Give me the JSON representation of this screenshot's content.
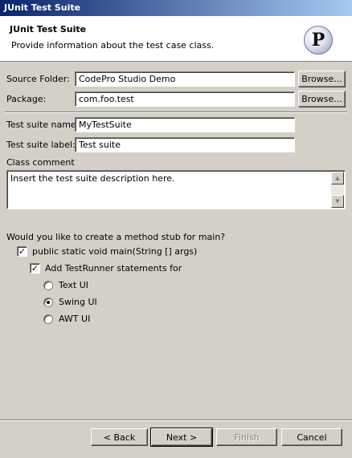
{
  "window": {
    "title": "JUnit Test Suite"
  },
  "header": {
    "title": "JUnit Test Suite",
    "description": "Provide information about the test case class.",
    "logo_letter": "P"
  },
  "form": {
    "source_folder": {
      "label": "Source Folder:",
      "value": "CodePro Studio Demo",
      "button": "Browse..."
    },
    "package": {
      "label": "Package:",
      "value": "com.foo.test",
      "button": "Browse..."
    },
    "suite_name": {
      "label": "Test suite name:",
      "value": "MyTestSuite"
    },
    "suite_label": {
      "label": "Test suite label:",
      "value": "Test suite"
    },
    "class_comment": {
      "label": "Class comment",
      "value": "Insert the test suite description here."
    }
  },
  "main_stub": {
    "question": "Would you like to create a method stub for main?",
    "main_checkbox": {
      "label": "public static void main(String [] args)",
      "checked": true
    },
    "runner_checkbox": {
      "label": "Add TestRunner statements for",
      "checked": true
    },
    "options": [
      {
        "label": "Text UI",
        "selected": false
      },
      {
        "label": "Swing UI",
        "selected": true
      },
      {
        "label": "AWT UI",
        "selected": false
      }
    ]
  },
  "footer": {
    "back": "< Back",
    "next": "Next >",
    "finish": "Finish",
    "cancel": "Cancel"
  }
}
